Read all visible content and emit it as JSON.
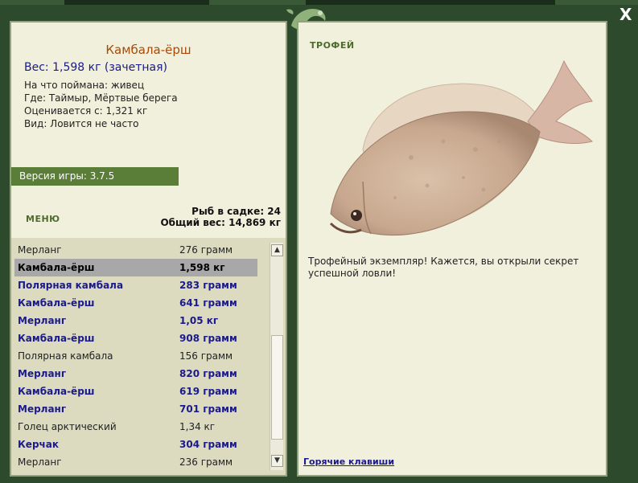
{
  "fish_info": {
    "name": "Камбала-ёрш",
    "weight_line": "Вес: 1,598 кг (зачетная)",
    "caught_on": "На что поймана: живец",
    "where": "Где: Таймыр, Мёртвые берега",
    "valued_from": "Оценивается с: 1,321 кг",
    "kind": "Вид: Ловится не часто"
  },
  "version": "Версия игры: 3.7.5",
  "menu_label": "МЕНЮ",
  "stats": {
    "fish_in_keepnet": "Рыб в садке: 24",
    "total_weight": "Общий вес: 14,869 кг"
  },
  "catch_list": [
    {
      "name": "Мерланг",
      "weight": "276 грамм",
      "style": "plain"
    },
    {
      "name": "Камбала-ёрш",
      "weight": "1,598 кг",
      "style": "selected"
    },
    {
      "name": "Полярная камбала",
      "weight": "283 грамм",
      "style": "bold"
    },
    {
      "name": "Камбала-ёрш",
      "weight": "641 грамм",
      "style": "bold"
    },
    {
      "name": "Мерланг",
      "weight": "1,05 кг",
      "style": "bold"
    },
    {
      "name": "Камбала-ёрш",
      "weight": "908 грамм",
      "style": "bold"
    },
    {
      "name": "Полярная камбала",
      "weight": "156 грамм",
      "style": "plain"
    },
    {
      "name": "Мерланг",
      "weight": "820 грамм",
      "style": "bold"
    },
    {
      "name": "Камбала-ёрш",
      "weight": "619 грамм",
      "style": "bold"
    },
    {
      "name": "Мерланг",
      "weight": "701 грамм",
      "style": "bold"
    },
    {
      "name": "Голец арктический",
      "weight": "1,34 кг",
      "style": "plain"
    },
    {
      "name": "Керчак",
      "weight": "304 грамм",
      "style": "bold"
    },
    {
      "name": "Мерланг",
      "weight": "236 грамм",
      "style": "plain"
    }
  ],
  "trophy": {
    "label": "ТРОФЕЙ",
    "text": "Трофейный экземпляр! Кажется, вы открыли секрет успешной ловли!"
  },
  "hotkeys_label": "Горячие клавиши",
  "close_label": "X",
  "colors": {
    "background": "#2e4a2c",
    "panel": "#f1f0dc",
    "accent_green": "#5a7d38",
    "title_orange": "#a84a08",
    "bold_blue": "#1a1a8c",
    "selected_row": "#a8a8a8"
  },
  "icons": [
    "frog-logo-icon",
    "close-icon",
    "scroll-up-arrow-icon",
    "scroll-down-arrow-icon",
    "flounder-fish-image"
  ]
}
